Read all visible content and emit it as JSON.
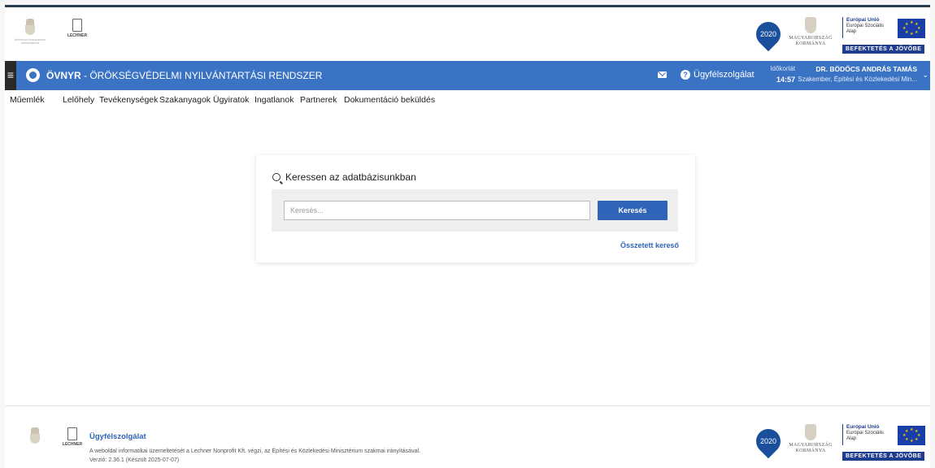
{
  "logos": {
    "ministry_caption": "ÉPÍTÉSI ÉS KÖZLEKEDÉSI MINISZTÉRIUM",
    "lechner": "LECHNER",
    "program": "2020",
    "government": [
      "MAGYARORSZÁG",
      "KORMÁNYA"
    ],
    "eu_title": "Európai Unió",
    "eu_fund": [
      "Európai Szociális",
      "Alap"
    ],
    "invest": "BEFEKTETÉS A JÖVŐBE"
  },
  "header": {
    "app_short": "ÖVNYR",
    "app_long": " - ÖRÖKSÉGVÉDELMI NYILVÁNTARTÁSI RENDSZER",
    "support_label": "Ügyfélszolgálat",
    "timer_label": "Időkorlát",
    "timer_value": "14:57",
    "user_name": "DR. BÖDŐCS ANDRÁS TAMÁS",
    "user_role": "Szakember, Építési és Közlekedési Min..."
  },
  "nav": {
    "items": [
      "Műemlék",
      "Lelőhely",
      "Tevékenységek",
      "Szakanyagok",
      "Ügyiratok",
      "Ingatlanok",
      "Partnerek",
      "Dokumentáció beküldés"
    ],
    "active": "Lelőhely"
  },
  "search": {
    "title": "Keressen az adatbázisunkban",
    "placeholder": "Keresés...",
    "button": "Keresés",
    "advanced_link": "Összetett kereső"
  },
  "footer": {
    "title": "Ügyfélszolgálat",
    "description": "A weboldal informatikai üzemeltetését a Lechner Nonprofit Kft. végzi, az Építési és Közlekedési Minisztérium szakmai irányításával.",
    "version": "Verzió: 2.36.1 (Készült 2025-07-07)"
  },
  "colors": {
    "header_blue": "#3a72c4",
    "accent": "#2f64b8",
    "eu_blue": "#1e3d8f"
  }
}
